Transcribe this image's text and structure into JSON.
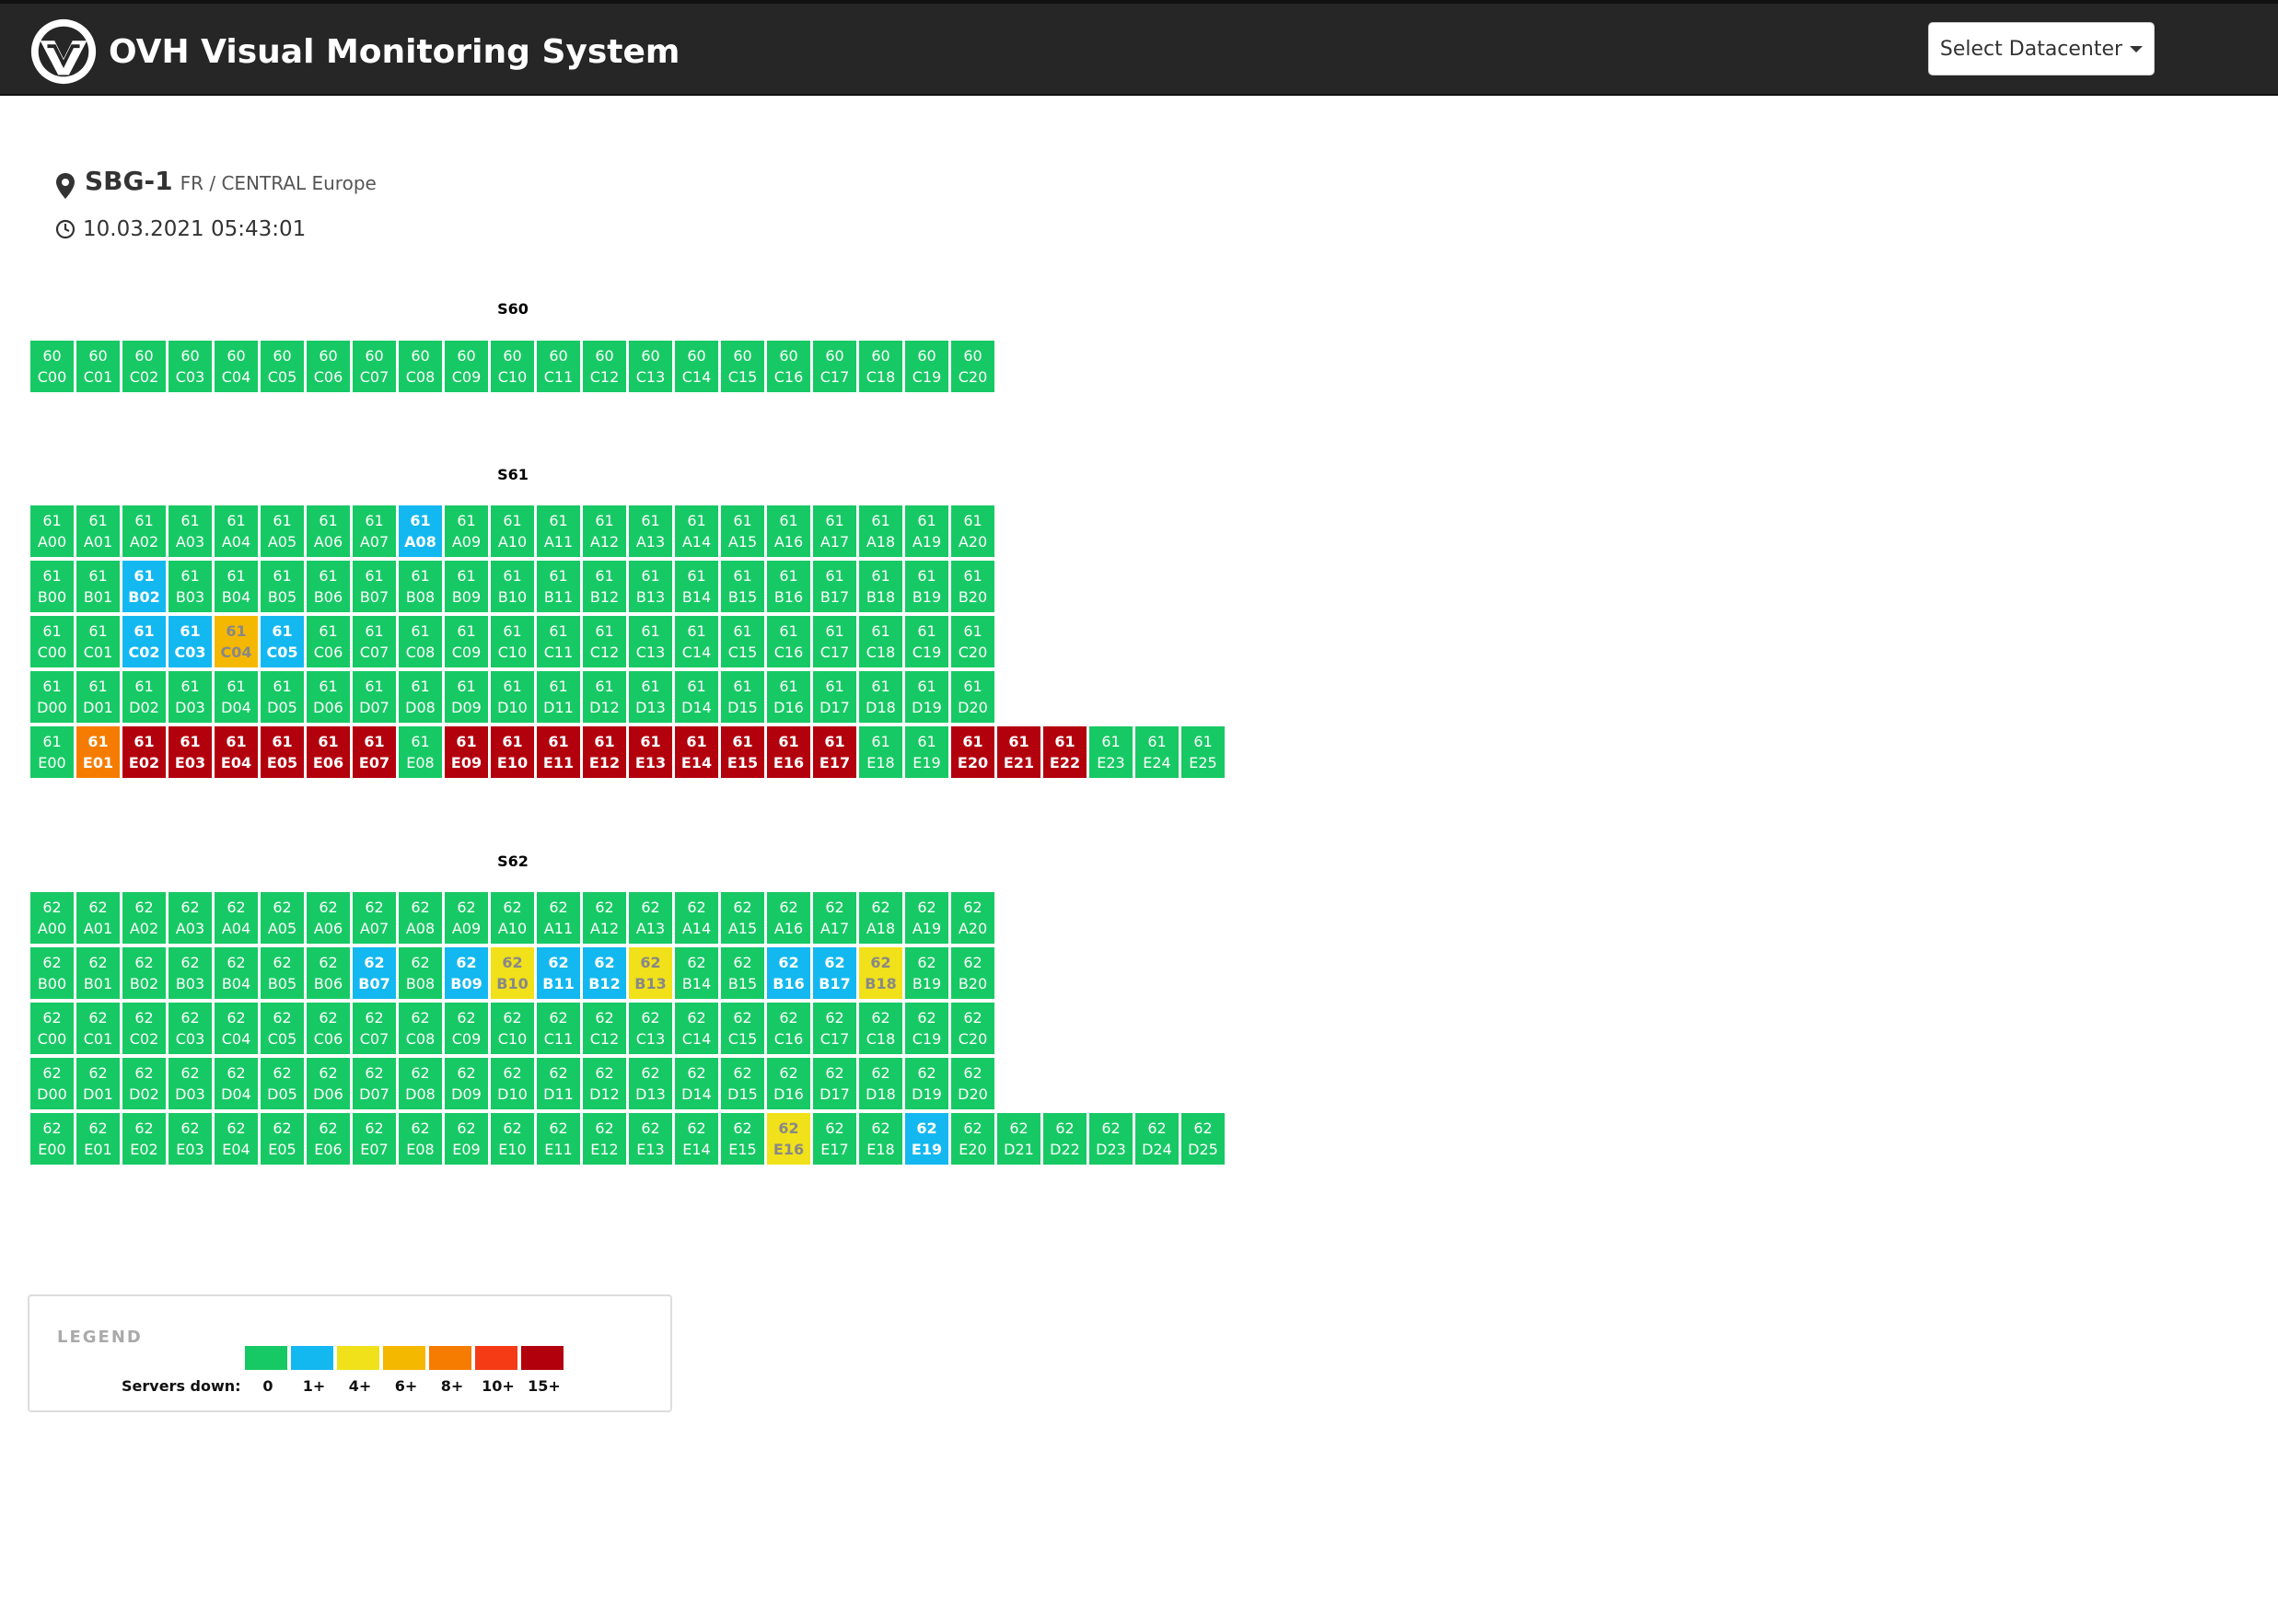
{
  "app": {
    "title": "OVH Visual Monitoring System",
    "select_label": "Select Datacenter"
  },
  "datacenter": {
    "name": "SBG-1",
    "region": "FR / CENTRAL Europe",
    "timestamp": "10.03.2021 05:43:01"
  },
  "colors": {
    "0": "#17c964",
    "1": "#14b8f0",
    "4": "#f0e11a",
    "6": "#f5b800",
    "8": "#f57c00",
    "10": "#f53a16",
    "15": "#b3000d"
  },
  "sections": [
    {
      "title": "S60",
      "rows": [
        {
          "num": "60",
          "letter": "C",
          "count": 21,
          "status": {}
        }
      ]
    },
    {
      "title": "S61",
      "rows": [
        {
          "num": "61",
          "letter": "A",
          "count": 21,
          "status": {
            "8": 1
          }
        },
        {
          "num": "61",
          "letter": "B",
          "count": 21,
          "status": {
            "2": 1
          }
        },
        {
          "num": "61",
          "letter": "C",
          "count": 21,
          "status": {
            "2": 1,
            "3": 1,
            "4": 6,
            "5": 1
          }
        },
        {
          "num": "61",
          "letter": "D",
          "count": 21,
          "status": {}
        },
        {
          "num": "61",
          "letter": "E",
          "count": 26,
          "status": {
            "1": 8,
            "2": 15,
            "3": 15,
            "4": 15,
            "5": 15,
            "6": 15,
            "7": 15,
            "9": 15,
            "10": 15,
            "11": 15,
            "12": 15,
            "13": 15,
            "14": 15,
            "15": 15,
            "16": 15,
            "17": 15,
            "20": 15,
            "21": 15,
            "22": 15
          }
        }
      ]
    },
    {
      "title": "S62",
      "rows": [
        {
          "num": "62",
          "letter": "A",
          "count": 21,
          "status": {}
        },
        {
          "num": "62",
          "letter": "B",
          "count": 21,
          "status": {
            "7": 1,
            "9": 1,
            "10": 4,
            "11": 1,
            "12": 1,
            "13": 4,
            "16": 1,
            "17": 1,
            "18": 4
          }
        },
        {
          "num": "62",
          "letter": "C",
          "count": 21,
          "status": {}
        },
        {
          "num": "62",
          "letter": "D",
          "count": 21,
          "status": {}
        },
        {
          "num": "62",
          "letter": "E",
          "count": 26,
          "status": {
            "16": 4,
            "19": 1
          },
          "overrides": {
            "21": "D21",
            "22": "D22",
            "23": "D23",
            "24": "D24",
            "25": "D25"
          }
        }
      ]
    }
  ],
  "legend": {
    "title": "LEGEND",
    "caption": "Servers down:",
    "levels": [
      "0",
      "1+",
      "4+",
      "6+",
      "8+",
      "10+",
      "15+"
    ]
  }
}
